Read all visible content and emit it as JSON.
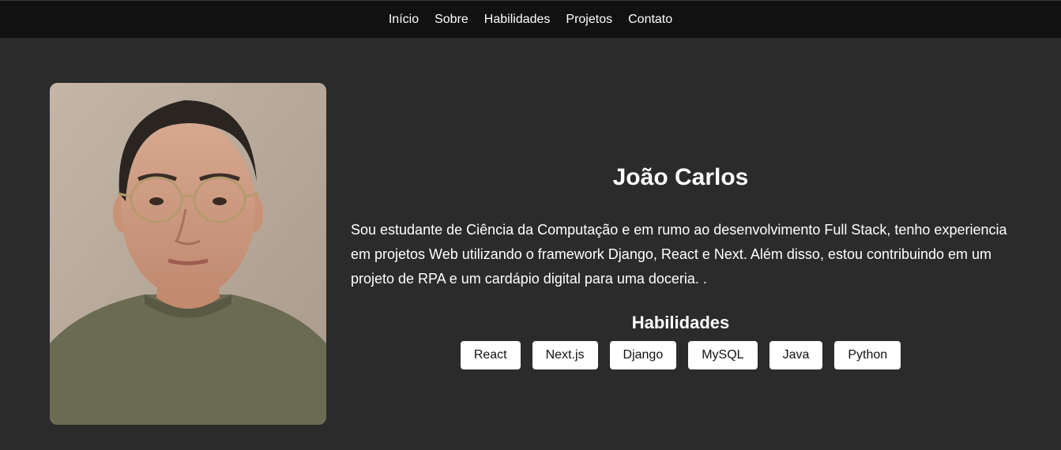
{
  "nav": {
    "items": [
      {
        "label": "Início"
      },
      {
        "label": "Sobre"
      },
      {
        "label": "Habilidades"
      },
      {
        "label": "Projetos"
      },
      {
        "label": "Contato"
      }
    ]
  },
  "profile": {
    "name": "João Carlos",
    "bio": "Sou estudante de Ciência da Computação e em rumo ao desenvolvimento Full Stack, tenho experiencia em projetos Web utilizando o framework Django, React e Next. Além disso, estou contribuindo em um projeto de RPA e um cardápio digital para uma doceria. .",
    "photo_icon": "profile-photo"
  },
  "skills": {
    "title": "Habilidades",
    "items": [
      "React",
      "Next.js",
      "Django",
      "MySQL",
      "Java",
      "Python"
    ]
  },
  "colors": {
    "background": "#2b2b2b",
    "nav_background": "#111111",
    "text": "#ffffff",
    "chip_background": "#ffffff",
    "chip_text": "#111111"
  }
}
